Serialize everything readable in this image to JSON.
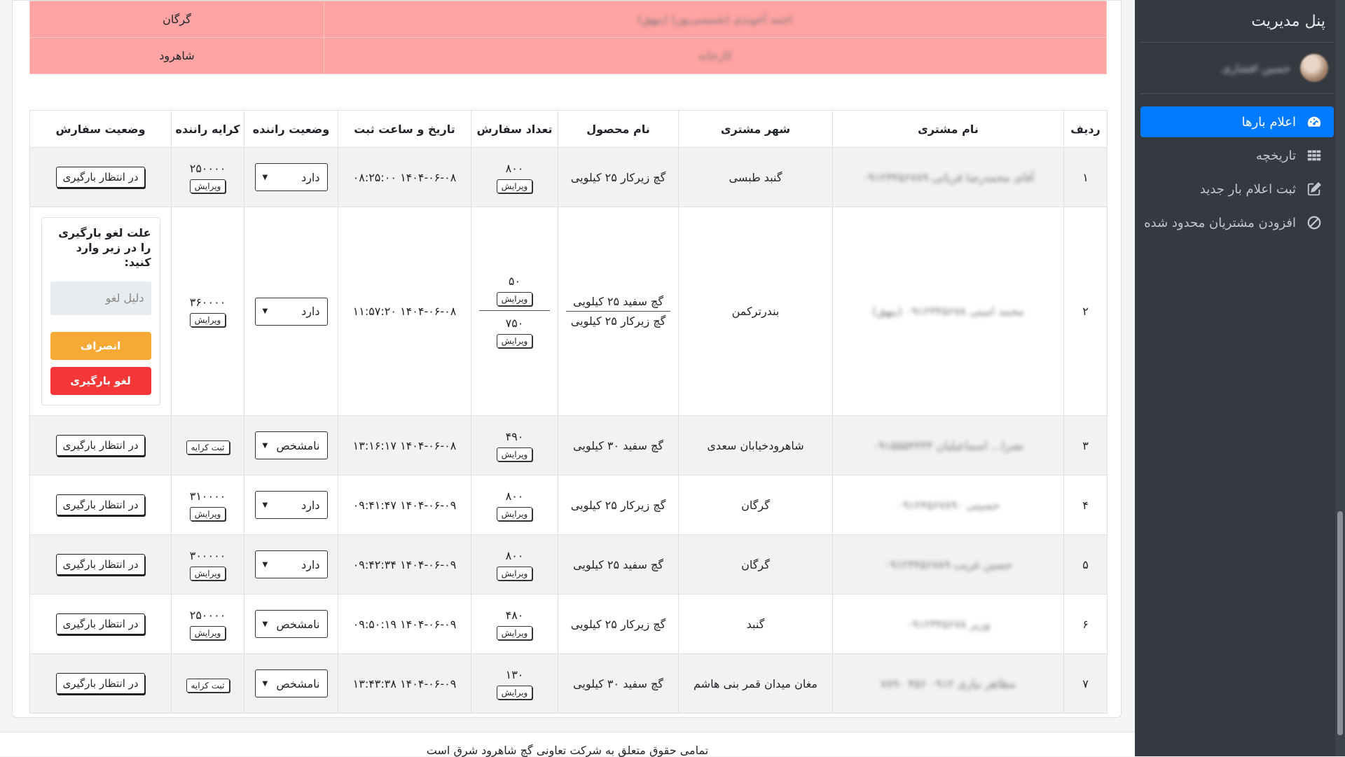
{
  "sidebar": {
    "brand": "پنل مدیریت",
    "user_name": "حسین افشاری",
    "items": [
      {
        "label": "اعلام بارها",
        "icon": "dashboard-icon",
        "active": true
      },
      {
        "label": "تاریخچه",
        "icon": "grid-icon",
        "active": false
      },
      {
        "label": "ثبت اعلام بار جدید",
        "icon": "edit-icon",
        "active": false
      },
      {
        "label": "افزودن مشتریان محدود شده",
        "icon": "ban-icon",
        "active": false
      }
    ]
  },
  "top_rows": [
    {
      "city": "گرگان",
      "name": "احمد آخوندی (شمسی‌پور) (بیهق)"
    },
    {
      "city": "شاهرود",
      "name": "کارخانه"
    }
  ],
  "table": {
    "headers": [
      "ردیف",
      "نام مشتری",
      "شهر مشتری",
      "نام محصول",
      "تعداد سفارش",
      "تاریخ و ساعت ثبت",
      "وضعیت راننده",
      "کرایه راننده",
      "وضعیت سفارش"
    ],
    "edit_label": "ویرایش",
    "register_fare_label": "ثبت کرایه",
    "waiting_label": "در انتظار بارگیری",
    "rows": [
      {
        "num": "۱",
        "customer": "آقای محمدرضا قربانی ۰۹۱۲۳۴۵۶۷۸۹",
        "city": "گنبد طبسی",
        "product": "گچ زیرکار ۲۵ کیلویی",
        "qty": "۸۰۰",
        "datetime": "۱۴۰۴-۰۶-۰۸ ۰۸:۲۵:۰۰",
        "driver": "دارد",
        "fare": "۲۵۰۰۰۰"
      },
      {
        "num": "۲",
        "customer": "محمد امینی ۰۹۱۲۳۴۵۶۷۸ (بیهق)",
        "city": "بندرترکمن",
        "product": "گچ سفید ۲۵ کیلویی",
        "product2": "گچ زیرکار ۲۵ کیلویی",
        "qty": "۵۰",
        "qty2": "۷۵۰",
        "datetime": "۱۴۰۴-۰۶-۰۸ ۱۱:۵۷:۲۰",
        "driver": "دارد",
        "fare": "۳۶۰۰۰۰"
      },
      {
        "num": "۳",
        "customer": "نصرا... اسماعیلیان ۰۹۱۵۵۵۴۴۳۳",
        "city": "شاهرودخیابان سعدی",
        "product": "گچ سفید ۳۰ کیلویی",
        "qty": "۴۹۰",
        "datetime": "۱۴۰۴-۰۶-۰۸ ۱۳:۱۶:۱۷",
        "driver": "نامشخص",
        "fare": ""
      },
      {
        "num": "۴",
        "customer": "حسینی ۰۹۱۲۴۵۶۷۸۹۰",
        "city": "گرگان",
        "product": "گچ زیرکار ۲۵ کیلویی",
        "qty": "۸۰۰",
        "datetime": "۱۴۰۴-۰۶-۰۹ ۰۹:۴۱:۴۷",
        "driver": "دارد",
        "fare": "۳۱۰۰۰۰"
      },
      {
        "num": "۵",
        "customer": "حسین غریب ۰۹۱۲۳۴۵۶۷۸۹",
        "city": "گرگان",
        "product": "گچ سفید ۲۵ کیلویی",
        "qty": "۸۰۰",
        "datetime": "۱۴۰۴-۰۶-۰۹ ۰۹:۴۲:۳۴",
        "driver": "دارد",
        "fare": "۳۰۰۰۰۰"
      },
      {
        "num": "۶",
        "customer": "وزیر ۰۹۱۲۳۴۵۶۷۸",
        "city": "گنبد",
        "product": "گچ زیرکار ۲۵ کیلویی",
        "qty": "۴۸۰",
        "datetime": "۱۴۰۴-۰۶-۰۹ ۰۹:۵۰:۱۹",
        "driver": "نامشخص",
        "fare": "۲۵۰۰۰۰"
      },
      {
        "num": "۷",
        "customer": "مظاهر نیازی ۰۹۱۲ ۴۵۶ ۷۸۹۰",
        "city": "مغان میدان قمر بنی هاشم",
        "product": "گچ سفید ۳۰ کیلویی",
        "qty": "۱۳۰",
        "datetime": "۱۴۰۴-۰۶-۰۹ ۱۳:۴۳:۳۸",
        "driver": "نامشخص",
        "fare": ""
      }
    ]
  },
  "cancel_form": {
    "question": "علت لغو بارگیری را در زیر وارد کنید:",
    "placeholder": "دلیل لغو",
    "dismiss_label": "انصراف",
    "confirm_label": "لغو بارگیری"
  },
  "footer": {
    "text": "تمامی حقوق متعلق به شرکت تعاونی گچ شاهرود شرق است"
  }
}
